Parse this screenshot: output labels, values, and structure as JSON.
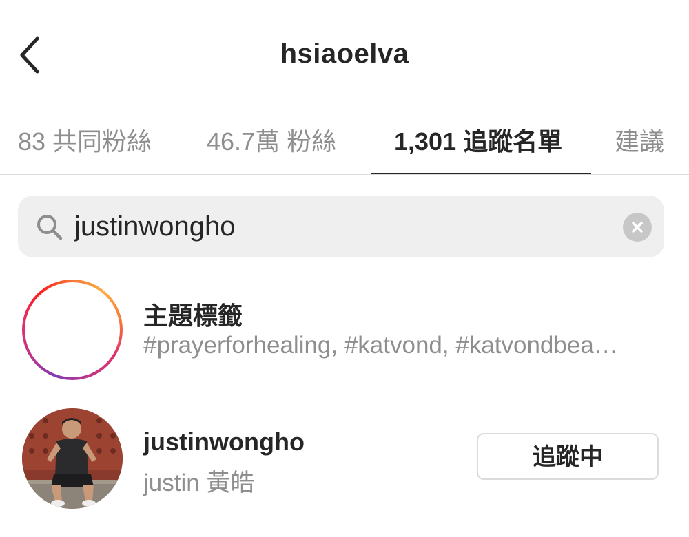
{
  "header": {
    "title": "hsiaoelva",
    "back_icon": "chevron-left-icon"
  },
  "tabs": [
    {
      "label": "83 共同粉絲",
      "active": false
    },
    {
      "label": "46.7萬 粉絲",
      "active": false
    },
    {
      "label": "1,301 追蹤名單",
      "active": true
    },
    {
      "label": "建議",
      "active": false
    }
  ],
  "search": {
    "value": "justinwongho",
    "search_icon": "search-icon",
    "clear_icon": "clear-icon"
  },
  "results": {
    "hashtag": {
      "title": "主題標籤",
      "subtitle": "#prayerforhealing, #katvond, #katvondbea…",
      "icon": "hashtag-icon"
    },
    "user": {
      "username": "justinwongho",
      "full_name": "justin 黃皓",
      "follow_label": "追蹤中"
    }
  },
  "colors": {
    "text_primary": "#262626",
    "text_secondary": "#8e8e8e",
    "search_bg": "#efefef",
    "divider": "#dbdbdb"
  }
}
